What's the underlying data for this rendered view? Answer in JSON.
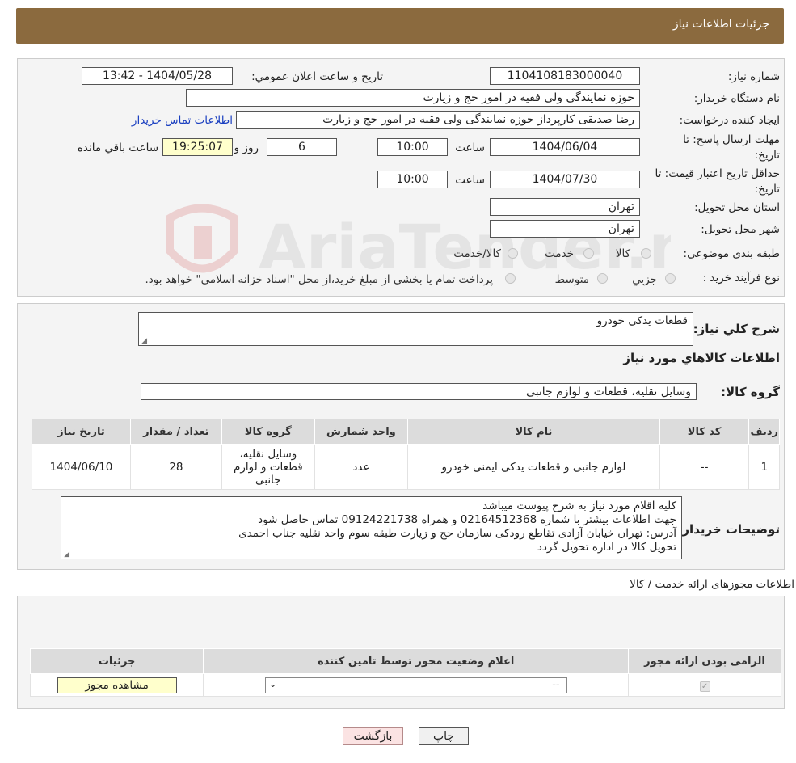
{
  "header": {
    "title": "جزئیات اطلاعات نیاز"
  },
  "form": {
    "need_number_label": "شماره نیاز:",
    "need_number": "1104108183000040",
    "announce_label": "تاريخ و ساعت اعلان عمومي:",
    "announce_value": "1404/05/28 - 13:42",
    "buyer_org_label": "نام دستگاه خريدار:",
    "buyer_org": "حوزه نمایندگی ولی فقیه در امور حج و زیارت",
    "creator_label": "ايجاد کننده درخواست:",
    "creator": "رضا صدیقی کارپرداز حوزه نمایندگی ولی فقیه در امور حج و زیارت",
    "contact_link": "اطلاعات تماس خريدار",
    "deadline_label": "مهلت ارسال پاسخ: تا تاريخ:",
    "deadline_date": "1404/06/04",
    "time_label": "ساعت",
    "deadline_time": "10:00",
    "days_value": "6",
    "days_label": "روز و",
    "remaining_time": "19:25:07",
    "remaining_label": "ساعت باقي مانده",
    "validity_label": "حداقل تاريخ اعتبار قيمت: تا تاريخ:",
    "validity_date": "1404/07/30",
    "validity_time": "10:00",
    "province_label": "استان محل تحويل:",
    "province": "تهران",
    "city_label": "شهر محل تحويل:",
    "city": "تهران",
    "category_label": "طبقه بندی موضوعی:",
    "category_options": [
      "کالا",
      "خدمت",
      "کالا/خدمت"
    ],
    "process_label": "نوع فرآيند خريد :",
    "process_options": [
      "جزيي",
      "متوسط"
    ],
    "process_note": "پرداخت تمام یا بخشی از مبلغ خرید،از محل \"اسناد خزانه اسلامی\" خواهد بود."
  },
  "summary": {
    "label": "شرح کلي نياز:",
    "value": "قطعات یدکی خودرو",
    "goods_info_title": "اطلاعات کالاهاي مورد نياز",
    "group_label": "گروه کالا:",
    "group_value": "وسایل نقلیه، قطعات و لوازم جانبی"
  },
  "goods_table": {
    "headers": [
      "رديف",
      "کد کالا",
      "نام کالا",
      "واحد شمارش",
      "گروه کالا",
      "تعداد / مقدار",
      "تاريخ نياز"
    ],
    "rows": [
      {
        "row": "1",
        "code": "--",
        "name": "لوازم جانبی و قطعات یدکی ایمنی خودرو",
        "unit": "عدد",
        "group": "وسایل نقلیه، قطعات و لوازم جانبی",
        "qty": "28",
        "date": "1404/06/10"
      }
    ]
  },
  "buyer_notes": {
    "label": "توضيحات خريدار:",
    "lines": [
      "کلیه اقلام مورد نیاز به شرح پیوست میباشد",
      "جهت اطلاعات بیشتر با شماره  02164512368 و همراه 09124221738 تماس حاصل شود",
      "آدرس: تهران خیابان آزادی تقاطع رودکی سازمان حج و زیارت طبقه سوم واحد نقلیه جناب احمدی",
      "تحویل کالا در اداره تحویل گردد"
    ]
  },
  "permits": {
    "title": "اطلاعات مجوزهای ارائه خدمت / کالا",
    "headers": [
      "الزامی بودن ارائه مجوز",
      "اعلام وضعیت مجوز توسط تامین کننده",
      "جزئیات"
    ],
    "select_value": "--",
    "view_button": "مشاهده مجوز"
  },
  "buttons": {
    "print": "چاپ",
    "back": "بازگشت"
  },
  "watermark": {
    "text": "AriaTender.neT"
  },
  "colors": {
    "header": "#8b6a3e",
    "link": "#1a3fc0",
    "remaining_bg": "#ffffcc",
    "back_bg": "#fbe3e3"
  }
}
